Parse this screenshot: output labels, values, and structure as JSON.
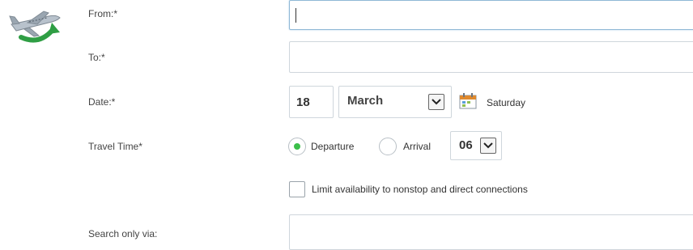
{
  "icon": {
    "name": "airplane-icon"
  },
  "form": {
    "from_label": "From:*",
    "from_value": "",
    "to_label": "To:*",
    "to_value": "",
    "date_label": "Date:*",
    "date_day": "18",
    "date_month": "March",
    "date_weekday": "Saturday",
    "travel_time_label": "Travel Time*",
    "departure_label": "Departure",
    "arrival_label": "Arrival",
    "departure_selected": true,
    "time_hour": "06",
    "limit_label": "Limit availability to nonstop and direct connections",
    "limit_checked": false,
    "via_label": "Search only via:",
    "via_value": ""
  },
  "colors": {
    "radio_selected": "#3bbf4a",
    "field_border": "#cfd6dc",
    "focus_border": "#8fb8d6"
  }
}
